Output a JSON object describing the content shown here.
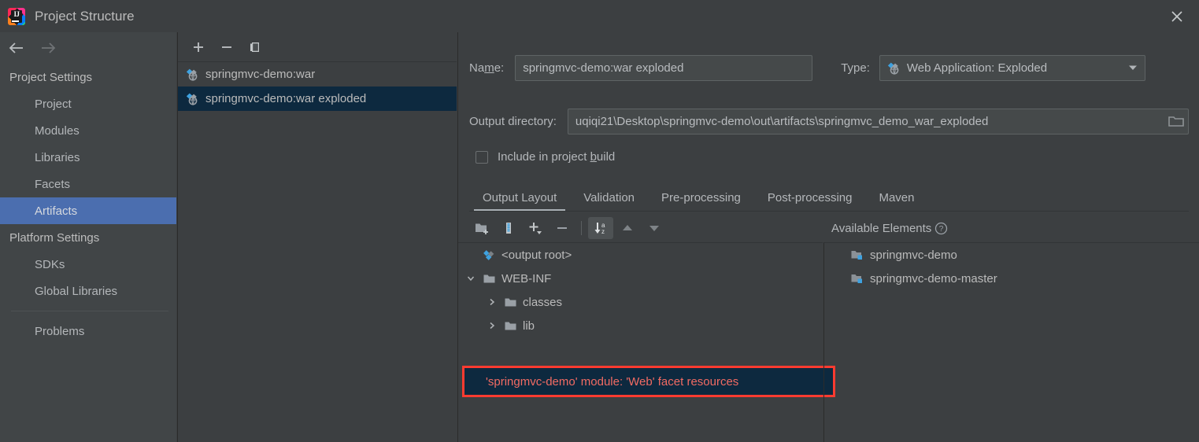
{
  "window": {
    "title": "Project Structure",
    "logo_text": "IJ",
    "close_icon": "close-icon"
  },
  "nav": {
    "back_icon": "arrow-left-icon",
    "forward_icon": "arrow-right-icon"
  },
  "sidebar": {
    "groups": [
      {
        "label": "Project Settings",
        "items": [
          {
            "label": "Project",
            "selected": false
          },
          {
            "label": "Modules",
            "selected": false
          },
          {
            "label": "Libraries",
            "selected": false
          },
          {
            "label": "Facets",
            "selected": false
          },
          {
            "label": "Artifacts",
            "selected": true
          }
        ]
      },
      {
        "label": "Platform Settings",
        "items": [
          {
            "label": "SDKs",
            "selected": false
          },
          {
            "label": "Global Libraries",
            "selected": false
          }
        ]
      }
    ],
    "problems_label": "Problems"
  },
  "artifacts_panel": {
    "toolbar": [
      {
        "name": "add-artifact-button",
        "icon": "plus-icon"
      },
      {
        "name": "remove-artifact-button",
        "icon": "minus-icon"
      },
      {
        "name": "copy-artifact-button",
        "icon": "copy-icon"
      }
    ],
    "items": [
      {
        "label": "springmvc-demo:war",
        "icon": "artifact-icon",
        "selected": false
      },
      {
        "label": "springmvc-demo:war exploded",
        "icon": "artifact-icon",
        "selected": true
      }
    ]
  },
  "detail": {
    "name_label_pre": "Na",
    "name_label_mnemonic": "m",
    "name_label_post": "e:",
    "name_value": "springmvc-demo:war exploded",
    "type_label": "Type:",
    "type_value": "Web Application: Exploded",
    "type_icon": "artifact-icon",
    "type_chevron": "chevron-down-icon",
    "output_dir_label": "Output directory:",
    "output_dir_value": "uqiqi21\\Desktop\\springmvc-demo\\out\\artifacts\\springmvc_demo_war_exploded",
    "browse_icon": "folder-browse-icon",
    "include_checkbox": {
      "label_pre": "Include in project ",
      "label_mnemonic": "b",
      "label_post": "uild",
      "checked": false
    },
    "tabs": [
      {
        "label": "Output Layout",
        "active": true
      },
      {
        "label": "Validation",
        "active": false
      },
      {
        "label": "Pre-processing",
        "active": false
      },
      {
        "label": "Post-processing",
        "active": false
      },
      {
        "label": "Maven",
        "active": false
      }
    ],
    "tree_toolbar": [
      {
        "name": "create-directory-button",
        "icon": "new-folder-icon",
        "pressed": false
      },
      {
        "name": "create-archive-button",
        "icon": "archive-icon",
        "pressed": false
      },
      {
        "name": "add-element-button",
        "icon": "plus-dropdown-icon",
        "pressed": false
      },
      {
        "name": "remove-element-button",
        "icon": "minus-icon",
        "pressed": false
      },
      {
        "name": "sort-elements-button",
        "icon": "sort-az-icon",
        "pressed": true
      },
      {
        "name": "move-up-button",
        "icon": "arrow-up-icon",
        "pressed": false
      },
      {
        "name": "move-down-button",
        "icon": "arrow-down-icon",
        "pressed": false
      }
    ],
    "available_elements_label": "Available Elements",
    "available_elements_help_icon": "help-icon",
    "output_tree": [
      {
        "label": "<output root>",
        "icon": "artifact-icon",
        "depth": 0,
        "chevron": "none"
      },
      {
        "label": "WEB-INF",
        "icon": "folder-icon",
        "depth": 0,
        "chevron": "down"
      },
      {
        "label": "classes",
        "icon": "folder-icon",
        "depth": 1,
        "chevron": "right"
      },
      {
        "label": "lib",
        "icon": "folder-icon",
        "depth": 1,
        "chevron": "right"
      }
    ],
    "highlighted_element": {
      "label": "'springmvc-demo' module: 'Web' facet resources",
      "highlight_color": "#fd3b30",
      "text_color": "#f26b63",
      "background": "#0d293f"
    },
    "available_elements": [
      {
        "label": "springmvc-demo",
        "icon": "module-icon"
      },
      {
        "label": "springmvc-demo-master",
        "icon": "module-icon"
      }
    ]
  }
}
